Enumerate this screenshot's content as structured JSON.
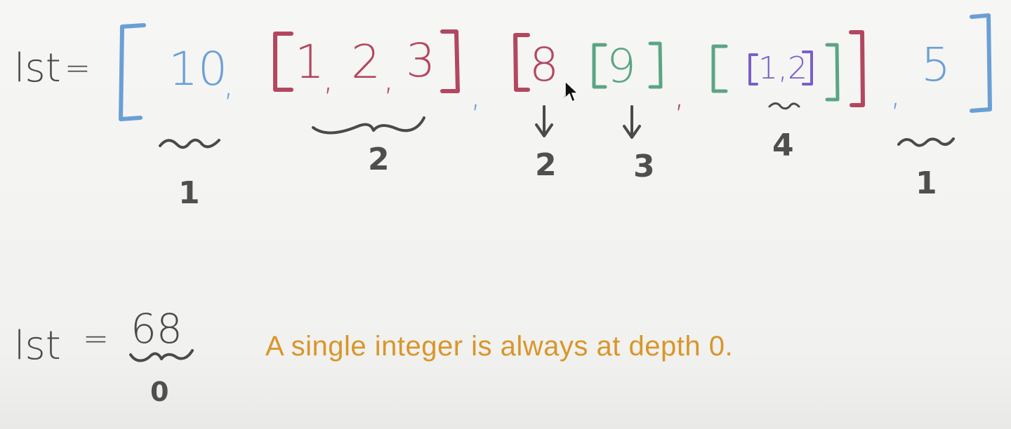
{
  "top": {
    "var_label": "lst",
    "equals": "=",
    "items": {
      "ten": "10",
      "comma_1": ",",
      "one": "1",
      "comma_a": ",",
      "two": "2",
      "comma_b": ",",
      "three": "3",
      "comma_2": ",",
      "eight": "8",
      "comma_3": ",",
      "nine": "9",
      "comma_4": ",",
      "inner_list": "1,2",
      "comma_5": ",",
      "five": "5"
    },
    "depths": {
      "ten": "1",
      "list_123": "2",
      "eight": "2",
      "nine": "3",
      "inner_list": "4",
      "five": "1"
    }
  },
  "bottom": {
    "var_label": "lst",
    "equals": "=",
    "value": "68",
    "depth": "0",
    "note": "A single integer is always at depth 0."
  },
  "colors": {
    "outer": "#6a9fd6",
    "level2": "#b3475f",
    "level3": "#5aa584",
    "level4": "#7a5fc8",
    "ink": "#4a4a4a",
    "note": "#d9962a"
  },
  "icons": [
    "mouse-cursor-icon"
  ]
}
